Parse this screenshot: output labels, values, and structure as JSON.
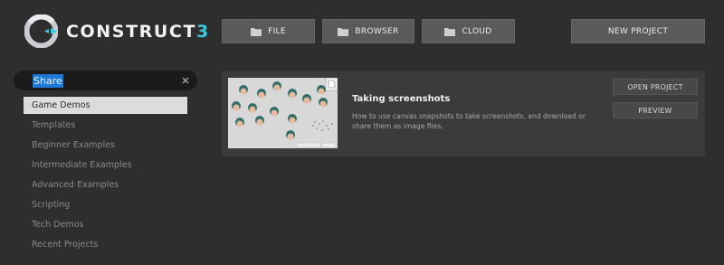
{
  "brand": {
    "name_text": "CONSTRUCT",
    "name_num": "3",
    "accent_color": "#37c8e2",
    "logo_icon": "construct-logo-icon"
  },
  "toolbar": {
    "file_label": "FILE",
    "browser_label": "BROWSER",
    "cloud_label": "CLOUD",
    "new_project_label": "NEW PROJECT",
    "folder_icon": "folder-icon"
  },
  "search": {
    "value": "Share",
    "clear_icon": "close-icon"
  },
  "categories": [
    {
      "label": "Game Demos",
      "active": true
    },
    {
      "label": "Templates",
      "active": false
    },
    {
      "label": "Beginner Examples",
      "active": false
    },
    {
      "label": "Intermediate Examples",
      "active": false
    },
    {
      "label": "Advanced Examples",
      "active": false
    },
    {
      "label": "Scripting",
      "active": false
    },
    {
      "label": "Tech Demos",
      "active": false
    },
    {
      "label": "Recent Projects",
      "active": false
    }
  ],
  "result": {
    "title": "Taking screenshots",
    "description": "How to use canvas snapshots to take screenshots, and download or share them as image files.",
    "open_label": "OPEN PROJECT",
    "preview_label": "PREVIEW",
    "thumbnail_icon": "screenshot-thumbnail"
  }
}
